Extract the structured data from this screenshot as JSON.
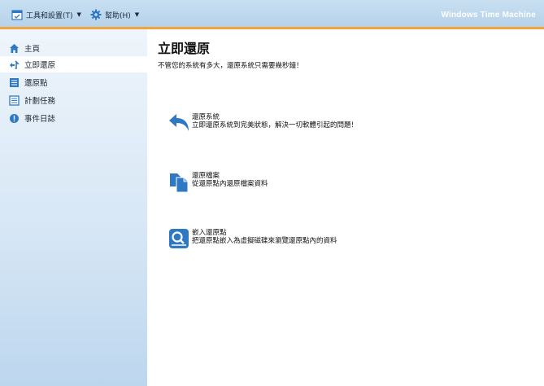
{
  "menu": {
    "tools_label": "工具和設置(T)",
    "help_label": "幫助(H)",
    "app_title": "Windows Time Machine"
  },
  "sidebar": {
    "items": [
      {
        "label": "主頁",
        "icon": "home-icon"
      },
      {
        "label": "立即還原",
        "icon": "restore-icon",
        "active": true
      },
      {
        "label": "還原點",
        "icon": "restore-point-icon"
      },
      {
        "label": "計劃任務",
        "icon": "schedule-icon"
      },
      {
        "label": "事件日誌",
        "icon": "event-log-icon"
      }
    ]
  },
  "main": {
    "title": "立即還原",
    "subtitle": "不管您的系統有多大，還原系統只需要幾秒鐘！",
    "actions": [
      {
        "title": "還原系統",
        "desc": "立即還原系統到完美狀態，解決一切軟體引起的問題！",
        "icon": "undo-arrow-icon"
      },
      {
        "title": "還原檔案",
        "desc": "從還原點內還原檔案資料",
        "icon": "files-icon"
      },
      {
        "title": "嵌入還原點",
        "desc": "把還原點嵌入為虛擬磁碟來瀏覽還原點內的資料",
        "icon": "disk-search-icon"
      }
    ]
  },
  "colors": {
    "accent": "#f2a33a",
    "icon_blue": "#2f78c3",
    "sidebar_top": "#eef5fb",
    "sidebar_bottom": "#bcd6ee"
  }
}
